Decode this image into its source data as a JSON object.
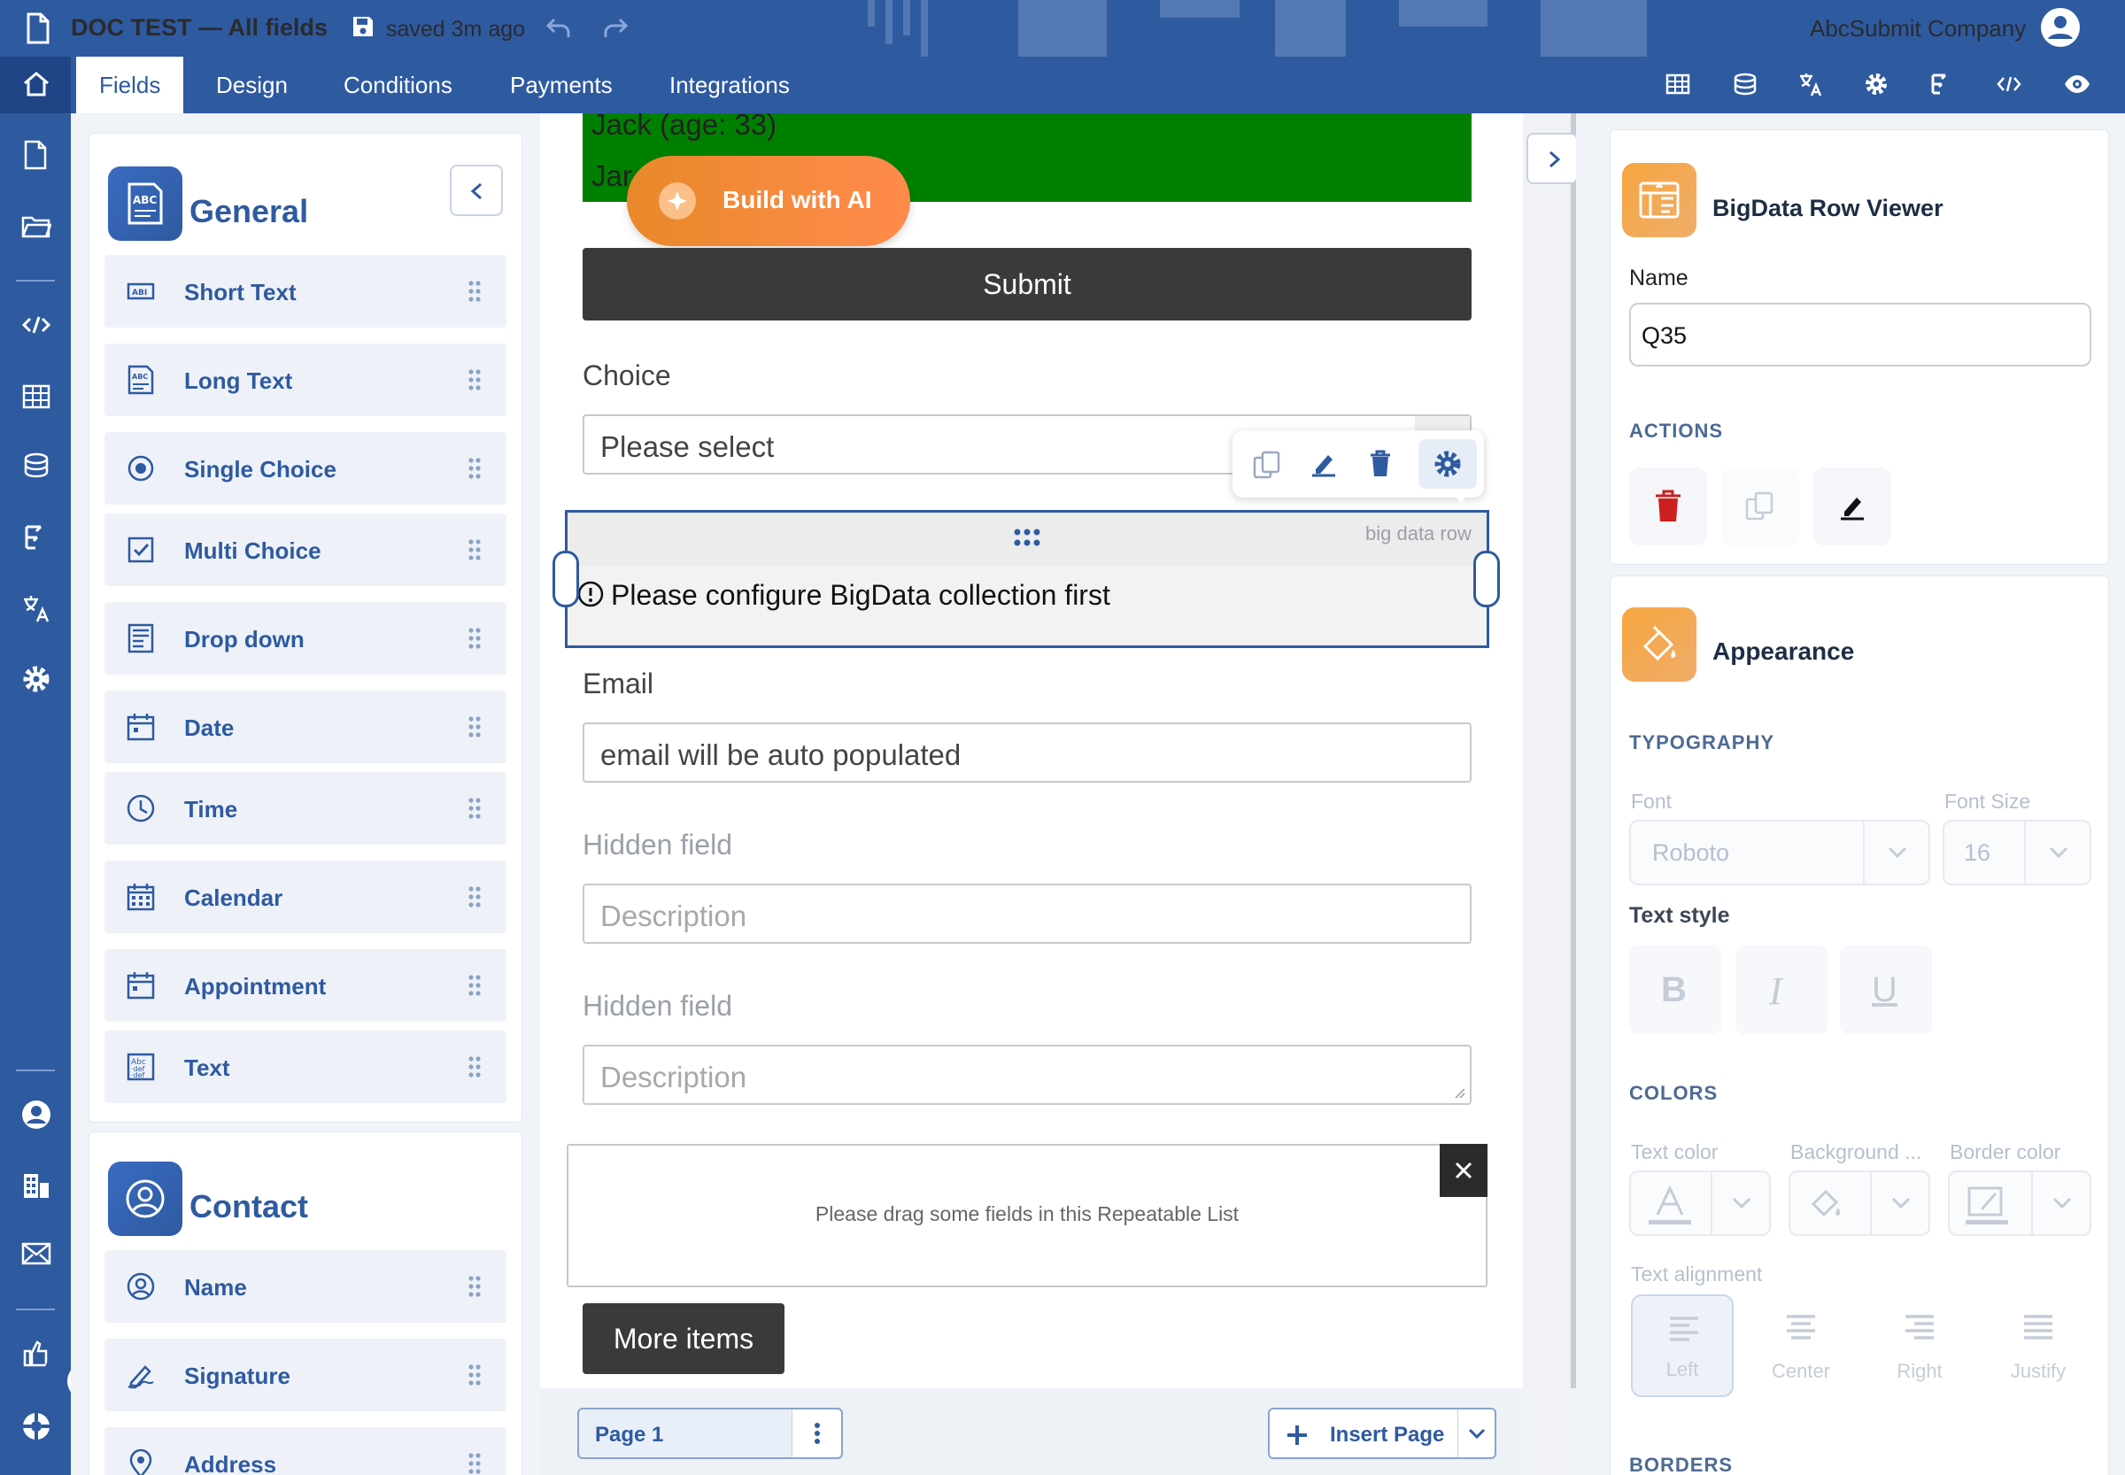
{
  "app": {
    "doc_title": "DOC TEST — All fields",
    "saved_status": "saved 3m ago",
    "company": "AbcSubmit Company"
  },
  "tabs": [
    {
      "label": "Fields",
      "active": true
    },
    {
      "label": "Design"
    },
    {
      "label": "Conditions"
    },
    {
      "label": "Payments"
    },
    {
      "label": "Integrations"
    }
  ],
  "toolbar_icons": [
    "table-icon",
    "bigdata-icon",
    "translate-icon",
    "settings-icon",
    "flow-icon",
    "embed-code-icon",
    "preview-eye-icon"
  ],
  "rail_icons": [
    "home-icon",
    "document-icon",
    "folder-icon",
    "code-icon",
    "table-icon",
    "bigdata-icon",
    "flow-icon",
    "translate-icon",
    "settings-icon",
    "user-icon",
    "company-icon",
    "mail-icon",
    "upgrade-icon",
    "support-icon"
  ],
  "left": {
    "general": {
      "title": "General",
      "items": [
        {
          "label": "Short Text",
          "icon": "short-text-icon"
        },
        {
          "label": "Long Text",
          "icon": "long-text-icon"
        },
        {
          "label": "Single Choice",
          "icon": "radio-icon"
        },
        {
          "label": "Multi Choice",
          "icon": "checkbox-icon"
        },
        {
          "label": "Drop down",
          "icon": "dropdown-icon"
        },
        {
          "label": "Date",
          "icon": "date-icon"
        },
        {
          "label": "Time",
          "icon": "clock-icon"
        },
        {
          "label": "Calendar",
          "icon": "calendar-icon"
        },
        {
          "label": "Appointment",
          "icon": "appointment-icon"
        },
        {
          "label": "Text",
          "icon": "text-icon"
        }
      ]
    },
    "contact": {
      "title": "Contact",
      "items": [
        {
          "label": "Name",
          "icon": "person-icon"
        },
        {
          "label": "Signature",
          "icon": "signature-icon"
        },
        {
          "label": "Address",
          "icon": "location-icon"
        }
      ]
    }
  },
  "form": {
    "list_items": [
      "Jack (age: 33)",
      "Jar"
    ],
    "build_ai_label": "Build with AI",
    "submit_label": "Submit",
    "choice_label": "Choice",
    "choice_placeholder": "Please select",
    "bigdata_tag": "big data row",
    "bigdata_message": "Please configure BigData collection first",
    "email_label": "Email",
    "email_placeholder": "email will be auto populated",
    "hidden1_label": "Hidden field",
    "hidden1_placeholder": "Description",
    "hidden2_label": "Hidden field",
    "hidden2_placeholder": "Description",
    "repeatable_text": "Please drag some fields in this Repeatable List",
    "more_items_label": "More items",
    "page_label": "Page 1",
    "insert_page_label": "Insert Page"
  },
  "right": {
    "widget_title": "BigData Row Viewer",
    "name_label": "Name",
    "name_value": "Q35",
    "actions_label": "ACTIONS",
    "appearance_title": "Appearance",
    "typography_label": "TYPOGRAPHY",
    "font_label": "Font",
    "font_value": "Roboto",
    "font_size_label": "Font Size",
    "font_size_value": "16",
    "text_style_label": "Text style",
    "colors_label": "COLORS",
    "text_color_label": "Text color",
    "background_label": "Background ...",
    "border_color_label": "Border color",
    "text_alignment_label": "Text alignment",
    "align_left": "Left",
    "align_center": "Center",
    "align_right": "Right",
    "align_justify": "Justify",
    "borders_label": "BORDERS"
  },
  "colors": {
    "brand": "#2e5aa0",
    "green_block": "#008000",
    "ai_gradient": "#f08a24",
    "accent_orange": "#f5a13a",
    "delete_red": "#cc1f1f"
  }
}
